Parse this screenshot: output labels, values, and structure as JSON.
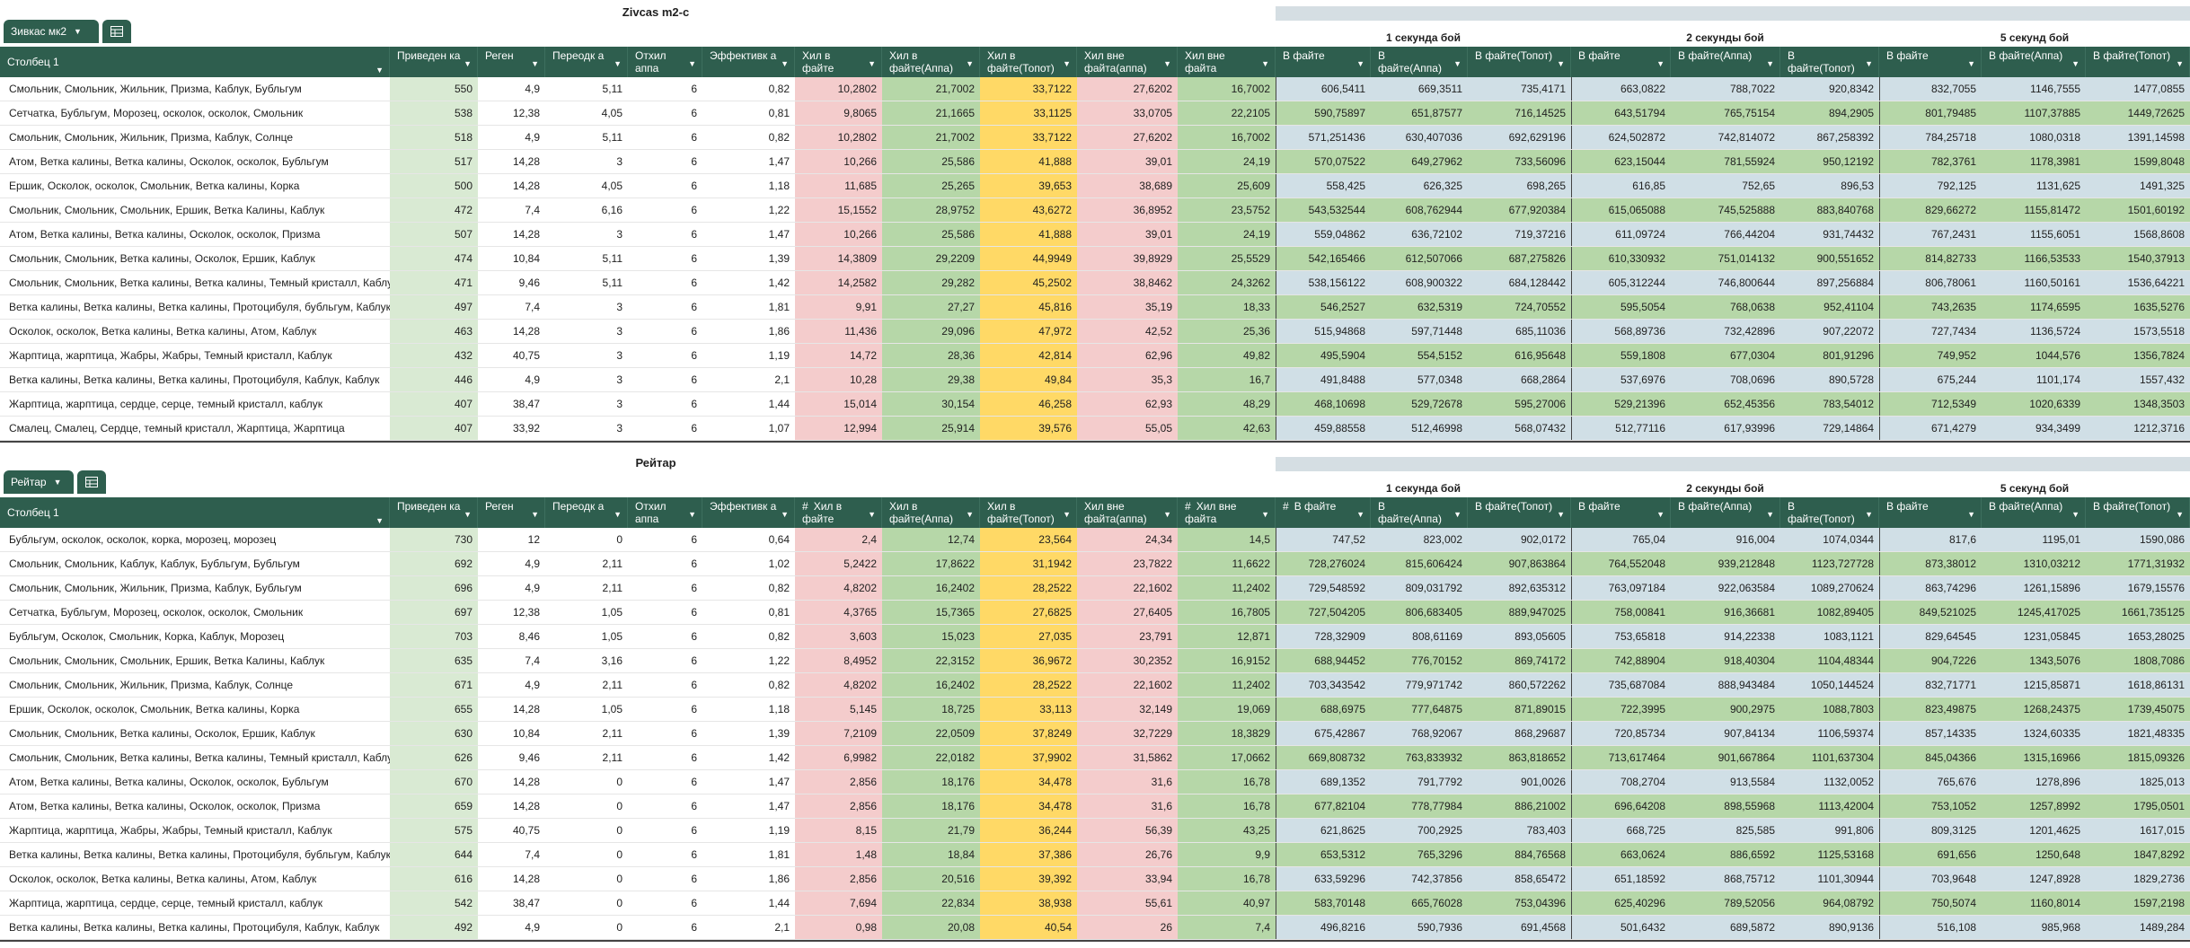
{
  "tables": [
    {
      "title": "Zivcas m2-c",
      "tab": {
        "label": "Зивкас мк2"
      },
      "groups": [
        "1 секунда бой",
        "2 секунды бой",
        "5 секунд бой"
      ],
      "headers": [
        "Столбец 1",
        "Приведен ка",
        "Реген",
        "Переодк а",
        "Отхил аппа",
        "Эффективк а",
        "Хил в файте",
        "Хил в файте(Аппа)",
        "Хил в файте(Топот)",
        "Хил вне файта(аппа)",
        "Хил вне файта",
        "В файте",
        "В файте(Аппа)",
        "В файте(Топот)",
        "В файте",
        "В файте(Аппа)",
        "В файте(Топот)",
        "В файте",
        "В файте(Аппа)",
        "В файте(Топот)"
      ],
      "rows": [
        [
          "Смольник, Смольник, Жильник, Призма, Каблук, Бубльгум",
          "550",
          "4,9",
          "5,11",
          "6",
          "0,82",
          "10,2802",
          "21,7002",
          "33,7122",
          "27,6202",
          "16,7002",
          "606,5411",
          "669,3511",
          "735,4171",
          "663,0822",
          "788,7022",
          "920,8342",
          "832,7055",
          "1146,7555",
          "1477,0855"
        ],
        [
          "Сетчатка, Бубльгум, Морозец, осколок, осколок, Смольник",
          "538",
          "12,38",
          "4,05",
          "6",
          "0,81",
          "9,8065",
          "21,1665",
          "33,1125",
          "33,0705",
          "22,2105",
          "590,75897",
          "651,87577",
          "716,14525",
          "643,51794",
          "765,75154",
          "894,2905",
          "801,79485",
          "1107,37885",
          "1449,72625"
        ],
        [
          "Смольник, Смольник, Жильник, Призма, Каблук, Солнце",
          "518",
          "4,9",
          "5,11",
          "6",
          "0,82",
          "10,2802",
          "21,7002",
          "33,7122",
          "27,6202",
          "16,7002",
          "571,251436",
          "630,407036",
          "692,629196",
          "624,502872",
          "742,814072",
          "867,258392",
          "784,25718",
          "1080,0318",
          "1391,14598"
        ],
        [
          "Атом, Ветка калины, Ветка калины, Осколок, осколок, Бубльгум",
          "517",
          "14,28",
          "3",
          "6",
          "1,47",
          "10,266",
          "25,586",
          "41,888",
          "39,01",
          "24,19",
          "570,07522",
          "649,27962",
          "733,56096",
          "623,15044",
          "781,55924",
          "950,12192",
          "782,3761",
          "1178,3981",
          "1599,8048"
        ],
        [
          "Ершик, Осколок, осколок, Смольник, Ветка калины, Корка",
          "500",
          "14,28",
          "4,05",
          "6",
          "1,18",
          "11,685",
          "25,265",
          "39,653",
          "38,689",
          "25,609",
          "558,425",
          "626,325",
          "698,265",
          "616,85",
          "752,65",
          "896,53",
          "792,125",
          "1131,625",
          "1491,325"
        ],
        [
          "Смольник, Смольник, Смольник, Ершик, Ветка Калины, Каблук",
          "472",
          "7,4",
          "6,16",
          "6",
          "1,22",
          "15,1552",
          "28,9752",
          "43,6272",
          "36,8952",
          "23,5752",
          "543,532544",
          "608,762944",
          "677,920384",
          "615,065088",
          "745,525888",
          "883,840768",
          "829,66272",
          "1155,81472",
          "1501,60192"
        ],
        [
          "Атом, Ветка калины, Ветка калины, Осколок, осколок, Призма",
          "507",
          "14,28",
          "3",
          "6",
          "1,47",
          "10,266",
          "25,586",
          "41,888",
          "39,01",
          "24,19",
          "559,04862",
          "636,72102",
          "719,37216",
          "611,09724",
          "766,44204",
          "931,74432",
          "767,2431",
          "1155,6051",
          "1568,8608"
        ],
        [
          "Смольник, Смольник, Ветка калины, Осколок, Ершик, Каблук",
          "474",
          "10,84",
          "5,11",
          "6",
          "1,39",
          "14,3809",
          "29,2209",
          "44,9949",
          "39,8929",
          "25,5529",
          "542,165466",
          "612,507066",
          "687,275826",
          "610,330932",
          "751,014132",
          "900,551652",
          "814,82733",
          "1166,53533",
          "1540,37913"
        ],
        [
          "Смольник, Смольник, Ветка калины, Ветка калины, Темный кристалл, Каблук",
          "471",
          "9,46",
          "5,11",
          "6",
          "1,42",
          "14,2582",
          "29,282",
          "45,2502",
          "38,8462",
          "24,3262",
          "538,156122",
          "608,900322",
          "684,128442",
          "605,312244",
          "746,800644",
          "897,256884",
          "806,78061",
          "1160,50161",
          "1536,64221"
        ],
        [
          "Ветка калины, Ветка калины, Ветка калины, Протоцибуля, бубльгум, Каблук",
          "497",
          "7,4",
          "3",
          "6",
          "1,81",
          "9,91",
          "27,27",
          "45,816",
          "35,19",
          "18,33",
          "546,2527",
          "632,5319",
          "724,70552",
          "595,5054",
          "768,0638",
          "952,41104",
          "743,2635",
          "1174,6595",
          "1635,5276"
        ],
        [
          "Осколок, осколок, Ветка калины, Ветка калины, Атом, Каблук",
          "463",
          "14,28",
          "3",
          "6",
          "1,86",
          "11,436",
          "29,096",
          "47,972",
          "42,52",
          "25,36",
          "515,94868",
          "597,71448",
          "685,11036",
          "568,89736",
          "732,42896",
          "907,22072",
          "727,7434",
          "1136,5724",
          "1573,5518"
        ],
        [
          "Жарптица, жарптица, Жабры, Жабры, Темный кристалл, Каблук",
          "432",
          "40,75",
          "3",
          "6",
          "1,19",
          "14,72",
          "28,36",
          "42,814",
          "62,96",
          "49,82",
          "495,5904",
          "554,5152",
          "616,95648",
          "559,1808",
          "677,0304",
          "801,91296",
          "749,952",
          "1044,576",
          "1356,7824"
        ],
        [
          "Ветка калины, Ветка калины, Ветка калины, Протоцибуля, Каблук, Каблук",
          "446",
          "4,9",
          "3",
          "6",
          "2,1",
          "10,28",
          "29,38",
          "49,84",
          "35,3",
          "16,7",
          "491,8488",
          "577,0348",
          "668,2864",
          "537,6976",
          "708,0696",
          "890,5728",
          "675,244",
          "1101,174",
          "1557,432"
        ],
        [
          "Жарптица, жарптица, сердце, серце, темный кристалл, каблук",
          "407",
          "38,47",
          "3",
          "6",
          "1,44",
          "15,014",
          "30,154",
          "46,258",
          "62,93",
          "48,29",
          "468,10698",
          "529,72678",
          "595,27006",
          "529,21396",
          "652,45356",
          "783,54012",
          "712,5349",
          "1020,6339",
          "1348,3503"
        ],
        [
          "Смалец, Смалец, Сердце, темный кристалл, Жарптица, Жарптица",
          "407",
          "33,92",
          "3",
          "6",
          "1,07",
          "12,994",
          "25,914",
          "39,576",
          "55,05",
          "42,63",
          "459,88558",
          "512,46998",
          "568,07432",
          "512,77116",
          "617,93996",
          "729,14864",
          "671,4279",
          "934,3499",
          "1212,3716"
        ]
      ]
    },
    {
      "title": "Рейтар",
      "tab": {
        "label": "Рейтар"
      },
      "groups": [
        "1 секунда бой",
        "2 секунды бой",
        "5 секунд бой"
      ],
      "headers": [
        "Столбец 1",
        "Приведен ка",
        "Реген",
        "Переодк а",
        "Отхил аппа",
        "Эффективк а",
        "Хил в файте",
        "Хил в файте(Аппа)",
        "Хил в файте(Топот)",
        "Хил вне файта(аппа)",
        "Хил вне файта",
        "В файте",
        "В файте(Аппа)",
        "В файте(Топот)",
        "В файте",
        "В файте(Аппа)",
        "В файте(Топот)",
        "В файте",
        "В файте(Аппа)",
        "В файте(Топот)"
      ],
      "rows": [
        [
          "Бубльгум, осколок, осколок, корка, морозец, морозец",
          "730",
          "12",
          "0",
          "6",
          "0,64",
          "2,4",
          "12,74",
          "23,564",
          "24,34",
          "14,5",
          "747,52",
          "823,002",
          "902,0172",
          "765,04",
          "916,004",
          "1074,0344",
          "817,6",
          "1195,01",
          "1590,086"
        ],
        [
          "Смольник, Смольник, Каблук, Каблук, Бубльгум, Бубльгум",
          "692",
          "4,9",
          "2,11",
          "6",
          "1,02",
          "5,2422",
          "17,8622",
          "31,1942",
          "23,7822",
          "11,6622",
          "728,276024",
          "815,606424",
          "907,863864",
          "764,552048",
          "939,212848",
          "1123,727728",
          "873,38012",
          "1310,03212",
          "1771,31932"
        ],
        [
          "Смольник, Смольник, Жильник, Призма, Каблук, Бубльгум",
          "696",
          "4,9",
          "2,11",
          "6",
          "0,82",
          "4,8202",
          "16,2402",
          "28,2522",
          "22,1602",
          "11,2402",
          "729,548592",
          "809,031792",
          "892,635312",
          "763,097184",
          "922,063584",
          "1089,270624",
          "863,74296",
          "1261,15896",
          "1679,15576"
        ],
        [
          "Сетчатка, Бубльгум, Морозец, осколок, осколок, Смольник",
          "697",
          "12,38",
          "1,05",
          "6",
          "0,81",
          "4,3765",
          "15,7365",
          "27,6825",
          "27,6405",
          "16,7805",
          "727,504205",
          "806,683405",
          "889,947025",
          "758,00841",
          "916,36681",
          "1082,89405",
          "849,521025",
          "1245,417025",
          "1661,735125"
        ],
        [
          "Бубльгум, Осколок, Смольник, Корка, Каблук, Морозец",
          "703",
          "8,46",
          "1,05",
          "6",
          "0,82",
          "3,603",
          "15,023",
          "27,035",
          "23,791",
          "12,871",
          "728,32909",
          "808,61169",
          "893,05605",
          "753,65818",
          "914,22338",
          "1083,1121",
          "829,64545",
          "1231,05845",
          "1653,28025"
        ],
        [
          "Смольник, Смольник, Смольник, Ершик, Ветка Калины, Каблук",
          "635",
          "7,4",
          "3,16",
          "6",
          "1,22",
          "8,4952",
          "22,3152",
          "36,9672",
          "30,2352",
          "16,9152",
          "688,94452",
          "776,70152",
          "869,74172",
          "742,88904",
          "918,40304",
          "1104,48344",
          "904,7226",
          "1343,5076",
          "1808,7086"
        ],
        [
          "Смольник, Смольник, Жильник, Призма, Каблук, Солнце",
          "671",
          "4,9",
          "2,11",
          "6",
          "0,82",
          "4,8202",
          "16,2402",
          "28,2522",
          "22,1602",
          "11,2402",
          "703,343542",
          "779,971742",
          "860,572262",
          "735,687084",
          "888,943484",
          "1050,144524",
          "832,71771",
          "1215,85871",
          "1618,86131"
        ],
        [
          "Ершик, Осколок, осколок, Смольник, Ветка калины, Корка",
          "655",
          "14,28",
          "1,05",
          "6",
          "1,18",
          "5,145",
          "18,725",
          "33,113",
          "32,149",
          "19,069",
          "688,6975",
          "777,64875",
          "871,89015",
          "722,3995",
          "900,2975",
          "1088,7803",
          "823,49875",
          "1268,24375",
          "1739,45075"
        ],
        [
          "Смольник, Смольник, Ветка калины, Осколок, Ершик, Каблук",
          "630",
          "10,84",
          "2,11",
          "6",
          "1,39",
          "7,2109",
          "22,0509",
          "37,8249",
          "32,7229",
          "18,3829",
          "675,42867",
          "768,92067",
          "868,29687",
          "720,85734",
          "907,84134",
          "1106,59374",
          "857,14335",
          "1324,60335",
          "1821,48335"
        ],
        [
          "Смольник, Смольник, Ветка калины, Ветка калины, Темный кристалл, Каблук",
          "626",
          "9,46",
          "2,11",
          "6",
          "1,42",
          "6,9982",
          "22,0182",
          "37,9902",
          "31,5862",
          "17,0662",
          "669,808732",
          "763,833932",
          "863,818652",
          "713,617464",
          "901,667864",
          "1101,637304",
          "845,04366",
          "1315,16966",
          "1815,09326"
        ],
        [
          "Атом, Ветка калины, Ветка калины, Осколок, осколок, Бубльгум",
          "670",
          "14,28",
          "0",
          "6",
          "1,47",
          "2,856",
          "18,176",
          "34,478",
          "31,6",
          "16,78",
          "689,1352",
          "791,7792",
          "901,0026",
          "708,2704",
          "913,5584",
          "1132,0052",
          "765,676",
          "1278,896",
          "1825,013"
        ],
        [
          "Атом, Ветка калины, Ветка калины, Осколок, осколок, Призма",
          "659",
          "14,28",
          "0",
          "6",
          "1,47",
          "2,856",
          "18,176",
          "34,478",
          "31,6",
          "16,78",
          "677,82104",
          "778,77984",
          "886,21002",
          "696,64208",
          "898,55968",
          "1113,42004",
          "753,1052",
          "1257,8992",
          "1795,0501"
        ],
        [
          "Жарптица, жарптица, Жабры, Жабры, Темный кристалл, Каблук",
          "575",
          "40,75",
          "0",
          "6",
          "1,19",
          "8,15",
          "21,79",
          "36,244",
          "56,39",
          "43,25",
          "621,8625",
          "700,2925",
          "783,403",
          "668,725",
          "825,585",
          "991,806",
          "809,3125",
          "1201,4625",
          "1617,015"
        ],
        [
          "Ветка калины, Ветка калины, Ветка калины, Протоцибуля, бубльгум, Каблук",
          "644",
          "7,4",
          "0",
          "6",
          "1,81",
          "1,48",
          "18,84",
          "37,386",
          "26,76",
          "9,9",
          "653,5312",
          "765,3296",
          "884,76568",
          "663,0624",
          "886,6592",
          "1125,53168",
          "691,656",
          "1250,648",
          "1847,8292"
        ],
        [
          "Осколок, осколок, Ветка калины, Ветка калины, Атом, Каблук",
          "616",
          "14,28",
          "0",
          "6",
          "1,86",
          "2,856",
          "20,516",
          "39,392",
          "33,94",
          "16,78",
          "633,59296",
          "742,37856",
          "858,65472",
          "651,18592",
          "868,75712",
          "1101,30944",
          "703,9648",
          "1247,8928",
          "1829,2736"
        ],
        [
          "Жарптица, жарптица, сердце, серце, темный кристалл, каблук",
          "542",
          "38,47",
          "0",
          "6",
          "1,44",
          "7,694",
          "22,834",
          "38,938",
          "55,61",
          "40,97",
          "583,70148",
          "665,76028",
          "753,04396",
          "625,40296",
          "789,52056",
          "964,08792",
          "750,5074",
          "1160,8014",
          "1597,2198"
        ],
        [
          "Ветка калины, Ветка калины, Ветка калины, Протоцибуля, Каблук, Каблук",
          "492",
          "4,9",
          "0",
          "6",
          "2,1",
          "0,98",
          "20,08",
          "40,54",
          "26",
          "7,4",
          "496,8216",
          "590,7936",
          "691,4568",
          "501,6432",
          "689,5872",
          "890,9136",
          "516,108",
          "985,968",
          "1489,284"
        ]
      ]
    }
  ],
  "colors": {
    "header_bg": "#2e5e4e",
    "green": "#d9ead3",
    "green_strong": "#b6d7a8",
    "red": "#f4cccc",
    "yellow": "#ffd966",
    "blue": "#d0dfe6"
  }
}
